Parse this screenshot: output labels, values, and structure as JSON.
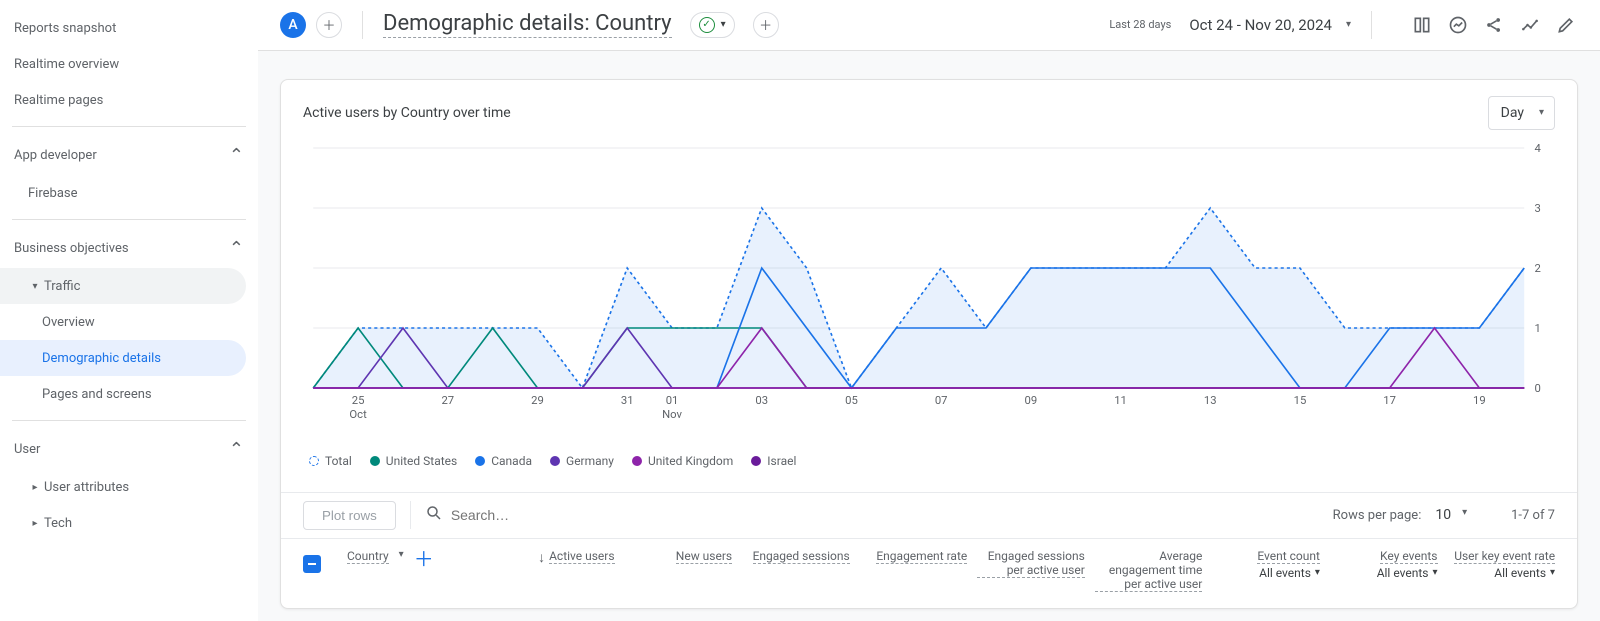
{
  "sidebar": {
    "reports_snapshot": "Reports snapshot",
    "realtime_overview": "Realtime overview",
    "realtime_pages": "Realtime pages",
    "app_developer": "App developer",
    "firebase": "Firebase",
    "business_objectives": "Business objectives",
    "traffic": "Traffic",
    "overview": "Overview",
    "demographic_details": "Demographic details",
    "pages_and_screens": "Pages and screens",
    "user": "User",
    "user_attributes": "User attributes",
    "tech": "Tech"
  },
  "header": {
    "avatar_letter": "A",
    "title": "Demographic details: Country",
    "date_label": "Last 28 days",
    "date_range": "Oct 24 - Nov 20, 2024"
  },
  "card": {
    "title": "Active users by Country over time",
    "granularity": "Day"
  },
  "legend": {
    "total": "Total",
    "us": "United States",
    "ca": "Canada",
    "de": "Germany",
    "uk": "United Kingdom",
    "il": "Israel"
  },
  "colors": {
    "total": "#1a73e8",
    "us": "#00897b",
    "ca": "#1a73e8",
    "de": "#5e35b1",
    "uk": "#8e24aa",
    "il": "#6a1b9a"
  },
  "toolbar": {
    "plot_rows": "Plot rows",
    "search_placeholder": "Search…",
    "rows_per_page_label": "Rows per page:",
    "rows_per_page_value": "10",
    "range_text": "1-7 of 7"
  },
  "columns": {
    "country": "Country",
    "active_users": "Active users",
    "new_users": "New users",
    "engaged_sessions": "Engaged sessions",
    "engagement_rate": "Engagement rate",
    "esau": "Engaged sessions per active user",
    "aet": "Average engagement time per active user",
    "event_count": "Event count",
    "key_events": "Key events",
    "user_key_event_rate": "User key event rate",
    "all_events": "All events"
  },
  "chart_data": {
    "type": "line",
    "ylabel": "",
    "ylim": [
      0,
      4
    ],
    "yticks": [
      0,
      1,
      2,
      3,
      4
    ],
    "x_dates": [
      "24 Oct",
      "25 Oct",
      "26 Oct",
      "27 Oct",
      "28 Oct",
      "29 Oct",
      "30 Oct",
      "31 Oct",
      "01 Nov",
      "02 Nov",
      "03 Nov",
      "04 Nov",
      "05 Nov",
      "06 Nov",
      "07 Nov",
      "08 Nov",
      "09 Nov",
      "10 Nov",
      "11 Nov",
      "12 Nov",
      "13 Nov",
      "14 Nov",
      "15 Nov",
      "16 Nov",
      "17 Nov",
      "18 Nov",
      "19 Nov",
      "20 Nov"
    ],
    "x_tick_labels": [
      {
        "top": "25",
        "bottom": "Oct"
      },
      {
        "top": "27",
        "bottom": ""
      },
      {
        "top": "29",
        "bottom": ""
      },
      {
        "top": "31",
        "bottom": ""
      },
      {
        "top": "01",
        "bottom": "Nov"
      },
      {
        "top": "03",
        "bottom": ""
      },
      {
        "top": "05",
        "bottom": ""
      },
      {
        "top": "07",
        "bottom": ""
      },
      {
        "top": "09",
        "bottom": ""
      },
      {
        "top": "11",
        "bottom": ""
      },
      {
        "top": "13",
        "bottom": ""
      },
      {
        "top": "15",
        "bottom": ""
      },
      {
        "top": "17",
        "bottom": ""
      },
      {
        "top": "19",
        "bottom": ""
      }
    ],
    "x_tick_positions": [
      1,
      3,
      5,
      7,
      8,
      10,
      12,
      14,
      16,
      18,
      20,
      22,
      24,
      26
    ],
    "series": [
      {
        "name": "Total",
        "color": "#1a73e8",
        "dashed": true,
        "fill": true,
        "values": [
          0,
          1,
          1,
          1,
          1,
          1,
          0,
          2,
          1,
          1,
          3,
          2,
          0,
          1,
          2,
          1,
          2,
          2,
          2,
          2,
          3,
          2,
          2,
          1,
          1,
          1,
          1,
          2
        ]
      },
      {
        "name": "United States",
        "color": "#00897b",
        "dashed": false,
        "fill": false,
        "values": [
          0,
          1,
          0,
          0,
          1,
          0,
          0,
          1,
          1,
          1,
          1,
          0,
          0,
          0,
          0,
          0,
          0,
          0,
          0,
          0,
          0,
          0,
          0,
          0,
          0,
          0,
          0,
          0
        ]
      },
      {
        "name": "Canada",
        "color": "#1a73e8",
        "dashed": false,
        "fill": false,
        "values": [
          0,
          0,
          0,
          0,
          0,
          0,
          0,
          0,
          0,
          0,
          2,
          1,
          0,
          1,
          1,
          1,
          2,
          2,
          2,
          2,
          2,
          1,
          0,
          0,
          1,
          1,
          1,
          2
        ]
      },
      {
        "name": "Germany",
        "color": "#5e35b1",
        "dashed": false,
        "fill": false,
        "values": [
          0,
          0,
          1,
          0,
          0,
          0,
          0,
          1,
          0,
          0,
          0,
          0,
          0,
          0,
          0,
          0,
          0,
          0,
          0,
          0,
          0,
          0,
          0,
          0,
          0,
          0,
          0,
          0
        ]
      },
      {
        "name": "United Kingdom",
        "color": "#8e24aa",
        "dashed": false,
        "fill": false,
        "values": [
          0,
          0,
          0,
          0,
          0,
          0,
          0,
          0,
          0,
          0,
          1,
          0,
          0,
          0,
          0,
          0,
          0,
          0,
          0,
          0,
          0,
          0,
          0,
          0,
          0,
          1,
          0,
          0
        ]
      },
      {
        "name": "Israel",
        "color": "#6a1b9a",
        "dashed": false,
        "fill": false,
        "values": [
          0,
          0,
          0,
          0,
          0,
          0,
          0,
          0,
          0,
          0,
          0,
          0,
          0,
          0,
          0,
          0,
          0,
          0,
          0,
          0,
          0,
          0,
          0,
          0,
          0,
          0,
          0,
          0
        ]
      }
    ]
  }
}
